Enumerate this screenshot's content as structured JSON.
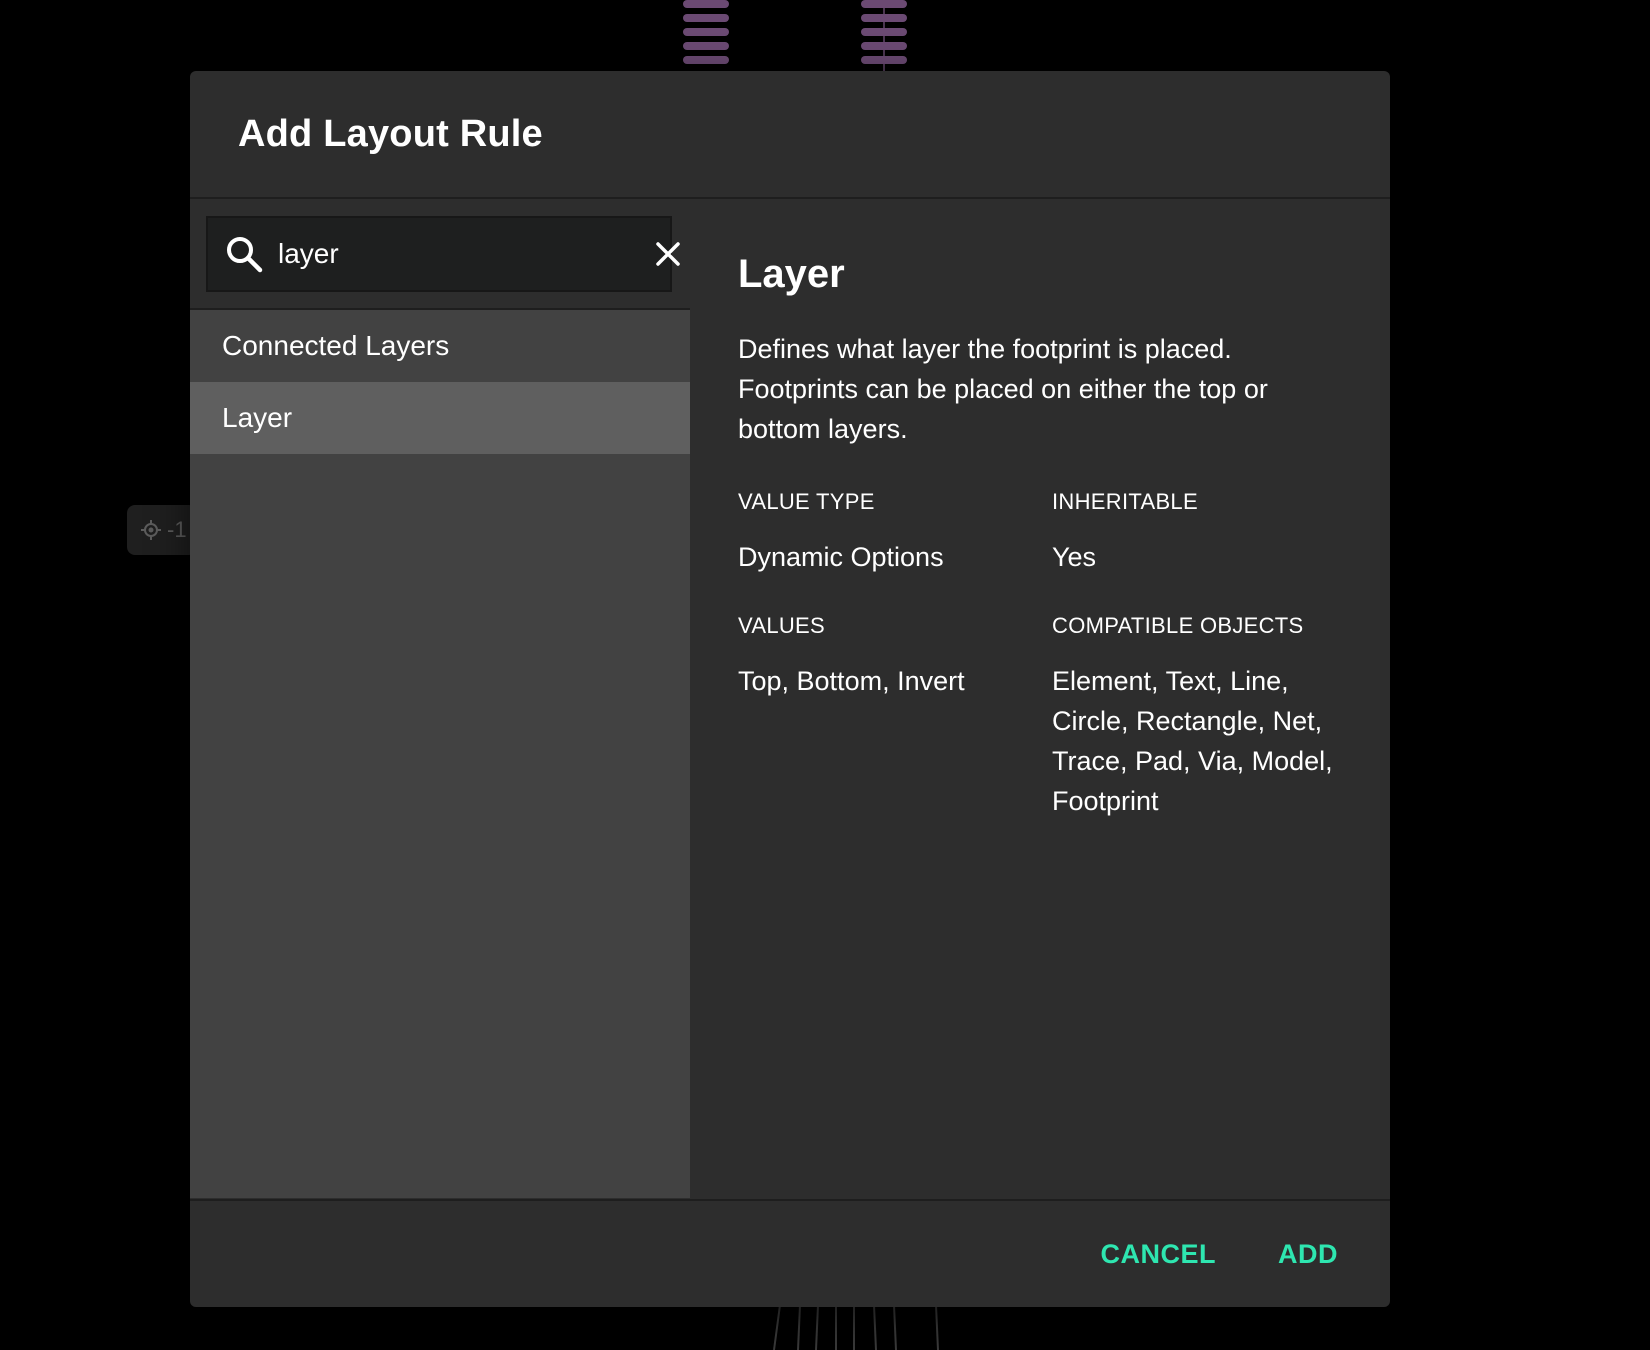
{
  "background": {
    "coordinate_chip": "-1"
  },
  "dialog": {
    "title": "Add Layout Rule",
    "search": {
      "value": "layer",
      "icon": "search-icon",
      "clear_icon": "close-icon"
    },
    "rule_list": [
      {
        "label": "Connected Layers",
        "selected": false
      },
      {
        "label": "Layer",
        "selected": true
      }
    ],
    "detail": {
      "title": "Layer",
      "description": "Defines what layer the footprint is placed. Footprints can be placed on either the top or bottom layers.",
      "value_type_label": "VALUE TYPE",
      "value_type": "Dynamic Options",
      "inheritable_label": "INHERITABLE",
      "inheritable": "Yes",
      "values_label": "VALUES",
      "values": "Top, Bottom, Invert",
      "compatible_label": "COMPATIBLE OBJECTS",
      "compatible": "Element, Text, Line, Circle, Rectangle, Net, Trace, Pad, Via, Model, Footprint"
    },
    "footer": {
      "cancel_label": "CANCEL",
      "add_label": "ADD"
    }
  },
  "colors": {
    "accent": "#2ee6b0",
    "dialog_bg": "#2d2d2d",
    "list_bg": "#424242",
    "selected_bg": "#5f5f5f",
    "pad": "#6b4a73"
  }
}
